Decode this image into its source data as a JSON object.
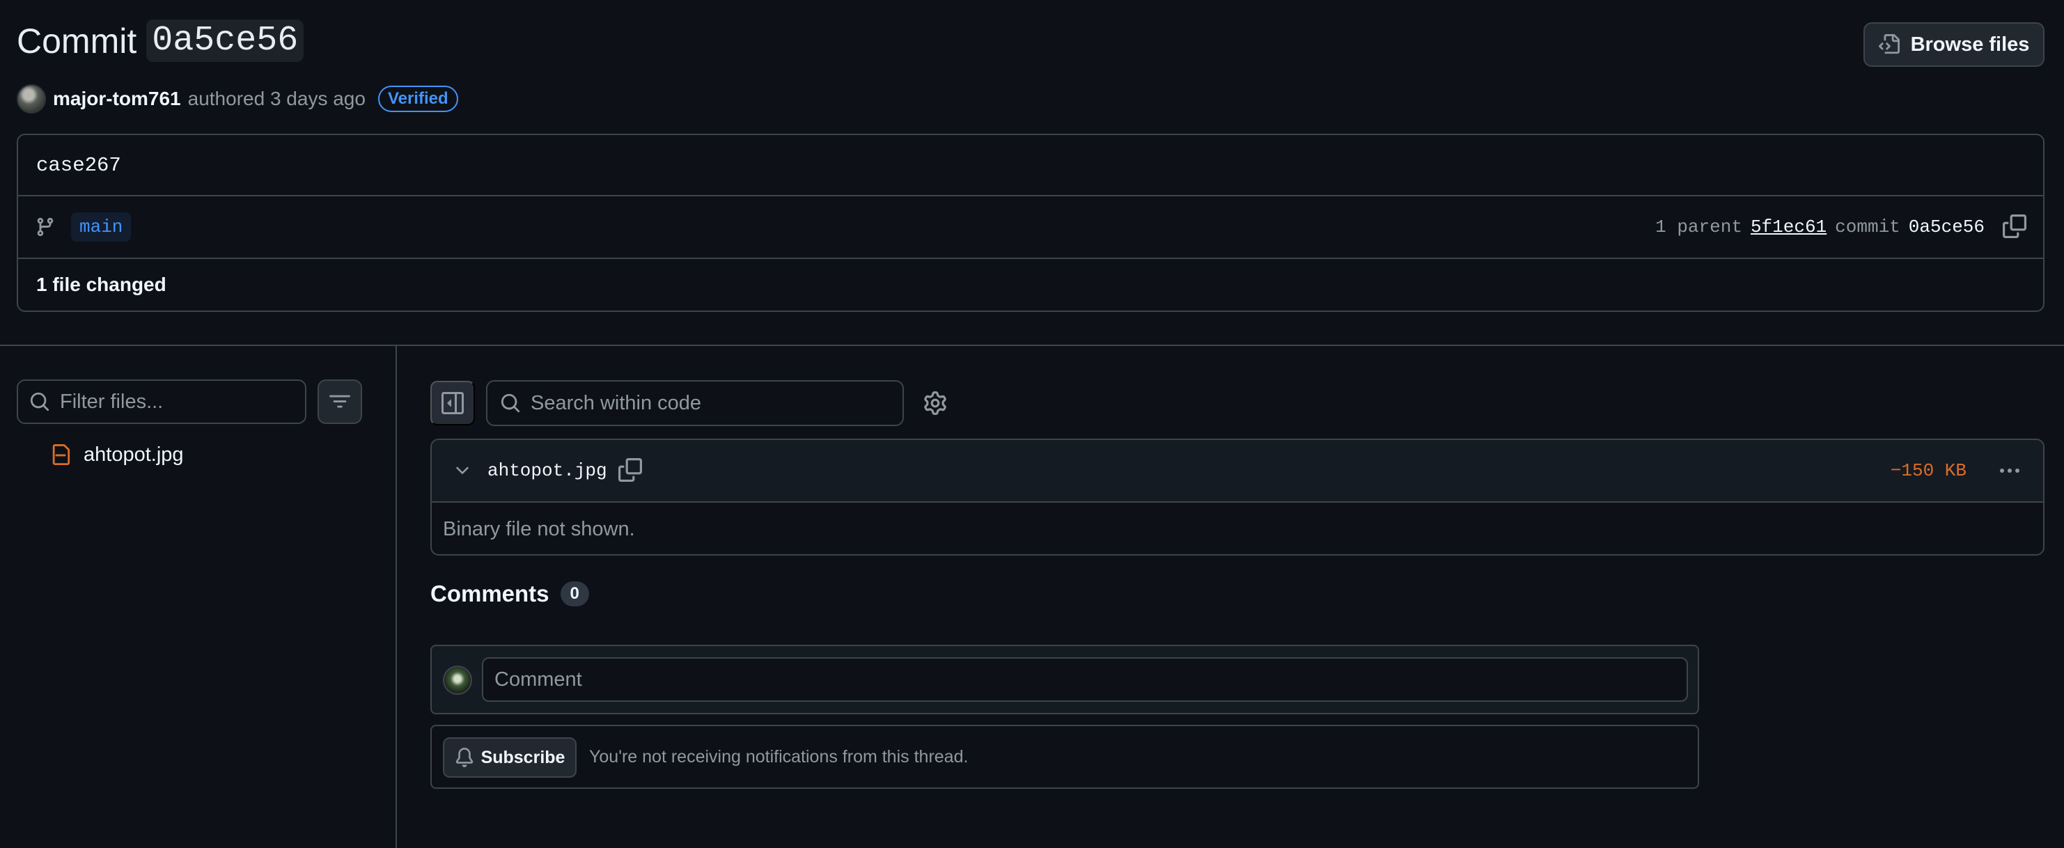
{
  "header": {
    "title_prefix": "Commit",
    "commit_sha": "0a5ce56",
    "browse_files_label": "Browse files"
  },
  "author": {
    "name": "major-tom761",
    "authored_text": "authored 3 days ago",
    "verified_label": "Verified"
  },
  "commit": {
    "message": "case267",
    "branch": "main",
    "parent_count_text": "1 parent",
    "parent_sha": "5f1ec61",
    "commit_label": "commit",
    "commit_sha": "0a5ce56",
    "files_changed": "1 file changed"
  },
  "file_tree": {
    "filter_placeholder": "Filter files...",
    "files": [
      {
        "name": "ahtopot.jpg",
        "status": "deleted"
      }
    ]
  },
  "diff_toolbar": {
    "search_placeholder": "Search within code"
  },
  "diff": {
    "filename": "ahtopot.jpg",
    "size_change": "−150 KB",
    "body_text": "Binary file not shown."
  },
  "comments": {
    "heading": "Comments",
    "count": "0",
    "input_placeholder": "Comment",
    "subscribe_label": "Subscribe",
    "subscribe_status": "You're not receiving notifications from this thread."
  },
  "colors": {
    "background": "#0d1117",
    "border": "#3d444d",
    "accent_blue": "#4493f8",
    "deleted_orange": "#db6d28",
    "muted_text": "#9198a1"
  },
  "icons": [
    "browse-files-icon",
    "git-branch-icon",
    "copy-icon",
    "search-icon",
    "filter-icon",
    "file-deleted-icon",
    "sidebar-collapse-icon",
    "gear-icon",
    "chevron-down-icon",
    "kebab-icon",
    "bell-icon"
  ]
}
